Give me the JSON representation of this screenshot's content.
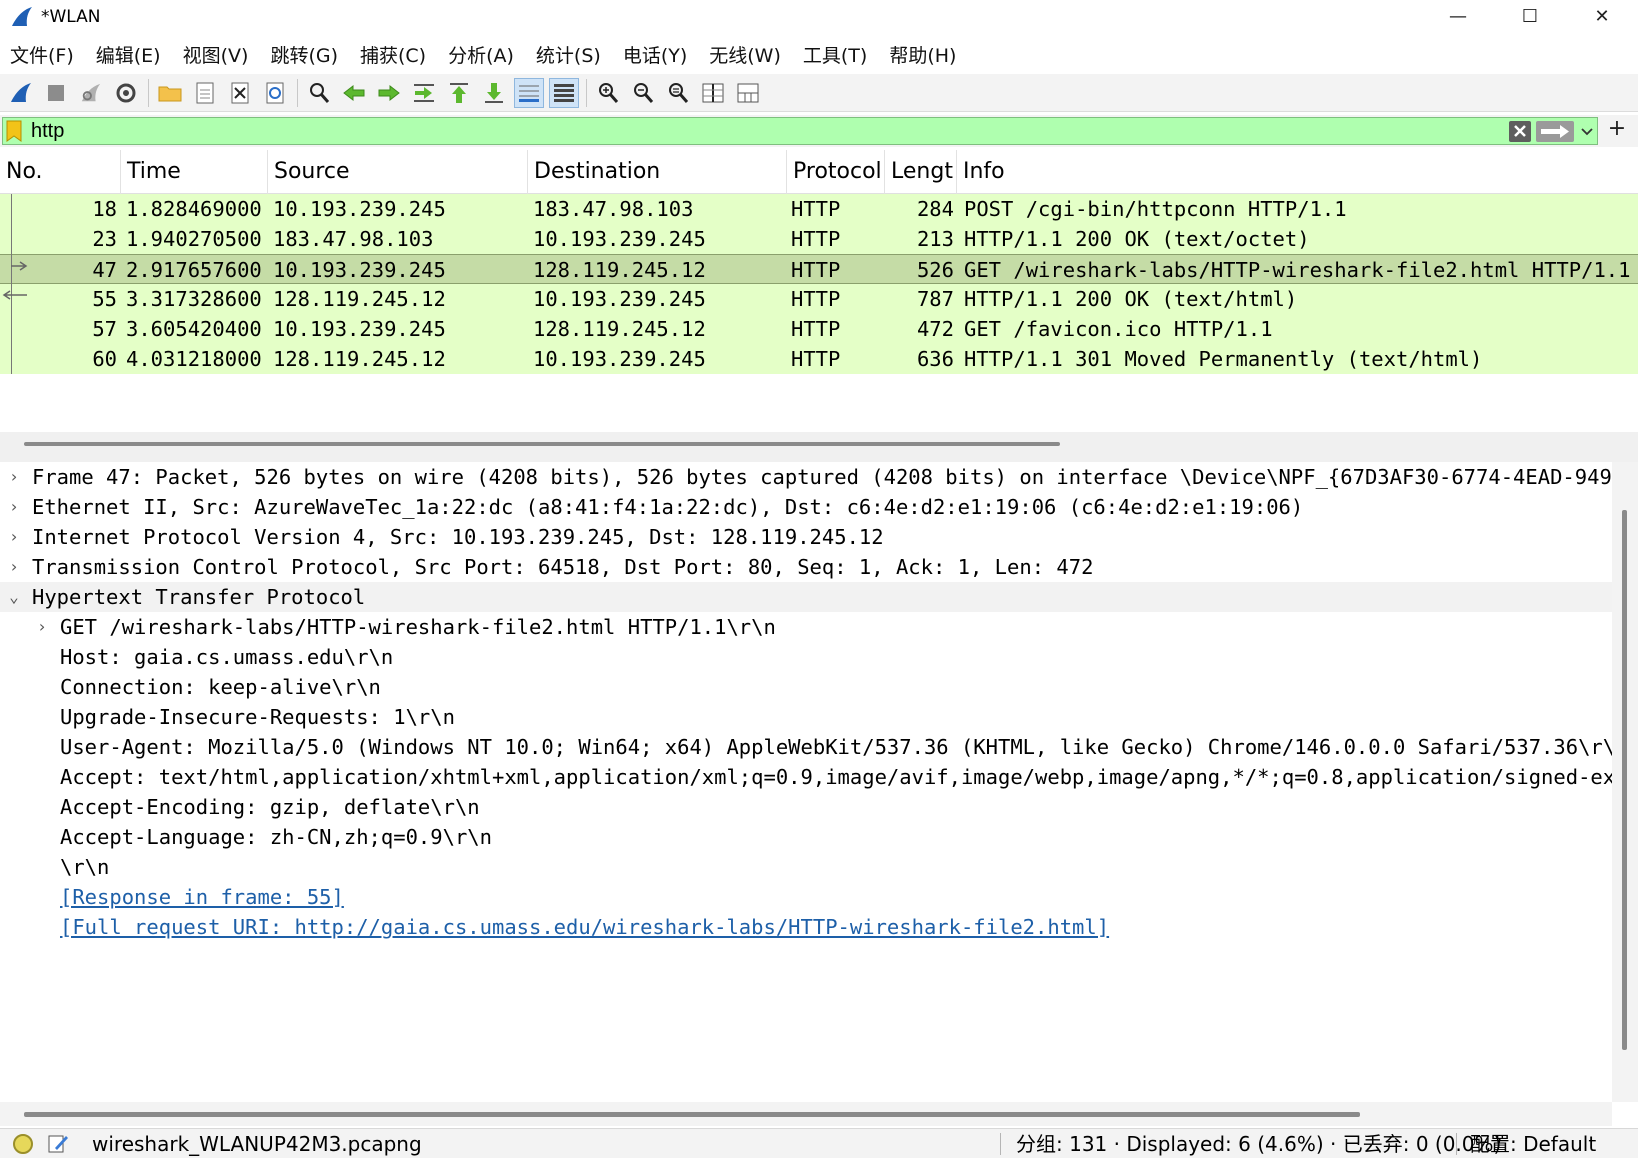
{
  "window": {
    "title": "*WLAN",
    "minimize": "—",
    "maximize": "☐",
    "close": "✕"
  },
  "menu": [
    "文件(F)",
    "编辑(E)",
    "视图(V)",
    "跳转(G)",
    "捕获(C)",
    "分析(A)",
    "统计(S)",
    "电话(Y)",
    "无线(W)",
    "工具(T)",
    "帮助(H)"
  ],
  "filter": {
    "value": "http",
    "add_label": "+"
  },
  "packet_list": {
    "columns": [
      "No.",
      "Time",
      "Source",
      "Destination",
      "Protocol",
      "Lengt",
      "Info"
    ],
    "rows": [
      {
        "no": "18",
        "time": "1.828469000",
        "src": "10.193.239.245",
        "dst": "183.47.98.103",
        "proto": "HTTP",
        "len": "284",
        "info": "POST /cgi-bin/httpconn HTTP/1.1"
      },
      {
        "no": "23",
        "time": "1.940270500",
        "src": "183.47.98.103",
        "dst": "10.193.239.245",
        "proto": "HTTP",
        "len": "213",
        "info": "HTTP/1.1 200 OK  (text/octet)"
      },
      {
        "no": "47",
        "time": "2.917657600",
        "src": "10.193.239.245",
        "dst": "128.119.245.12",
        "proto": "HTTP",
        "len": "526",
        "info": "GET /wireshark-labs/HTTP-wireshark-file2.html HTTP/1.1"
      },
      {
        "no": "55",
        "time": "3.317328600",
        "src": "128.119.245.12",
        "dst": "10.193.239.245",
        "proto": "HTTP",
        "len": "787",
        "info": "HTTP/1.1 200 OK  (text/html)"
      },
      {
        "no": "57",
        "time": "3.605420400",
        "src": "10.193.239.245",
        "dst": "128.119.245.12",
        "proto": "HTTP",
        "len": "472",
        "info": "GET /favicon.ico HTTP/1.1"
      },
      {
        "no": "60",
        "time": "4.031218000",
        "src": "128.119.245.12",
        "dst": "10.193.239.245",
        "proto": "HTTP",
        "len": "636",
        "info": "HTTP/1.1 301 Moved Permanently  (text/html)"
      }
    ],
    "selected_row": 2
  },
  "details": [
    {
      "level": 0,
      "arrow": "›",
      "text": "Frame 47: Packet, 526 bytes on wire (4208 bits), 526 bytes captured (4208 bits) on interface \\Device\\NPF_{67D3AF30-6774-4EAD-949"
    },
    {
      "level": 0,
      "arrow": "›",
      "text": "Ethernet II, Src: AzureWaveTec_1a:22:dc (a8:41:f4:1a:22:dc), Dst: c6:4e:d2:e1:19:06 (c6:4e:d2:e1:19:06)"
    },
    {
      "level": 0,
      "arrow": "›",
      "text": "Internet Protocol Version 4, Src: 10.193.239.245, Dst: 128.119.245.12"
    },
    {
      "level": 0,
      "arrow": "›",
      "text": "Transmission Control Protocol, Src Port: 64518, Dst Port: 80, Seq: 1, Ack: 1, Len: 472"
    },
    {
      "level": 0,
      "arrow": "⌄",
      "text": "Hypertext Transfer Protocol",
      "expanded": true
    },
    {
      "level": 1,
      "arrow": "›",
      "text": "GET /wireshark-labs/HTTP-wireshark-file2.html HTTP/1.1\\r\\n"
    },
    {
      "level": 1,
      "arrow": "",
      "text": "Host: gaia.cs.umass.edu\\r\\n"
    },
    {
      "level": 1,
      "arrow": "",
      "text": "Connection: keep-alive\\r\\n"
    },
    {
      "level": 1,
      "arrow": "",
      "text": "Upgrade-Insecure-Requests: 1\\r\\n"
    },
    {
      "level": 1,
      "arrow": "",
      "text": "User-Agent: Mozilla/5.0 (Windows NT 10.0; Win64; x64) AppleWebKit/537.36 (KHTML, like Gecko) Chrome/146.0.0.0 Safari/537.36\\r\\"
    },
    {
      "level": 1,
      "arrow": "",
      "text": "Accept: text/html,application/xhtml+xml,application/xml;q=0.9,image/avif,image/webp,image/apng,*/*;q=0.8,application/signed-ex"
    },
    {
      "level": 1,
      "arrow": "",
      "text": "Accept-Encoding: gzip, deflate\\r\\n"
    },
    {
      "level": 1,
      "arrow": "",
      "text": "Accept-Language: zh-CN,zh;q=0.9\\r\\n"
    },
    {
      "level": 1,
      "arrow": "",
      "text": "\\r\\n"
    },
    {
      "level": 1,
      "arrow": "",
      "text": "[Response in frame: 55]",
      "link": true
    },
    {
      "level": 1,
      "arrow": "",
      "text": "[Full request URI: http://gaia.cs.umass.edu/wireshark-labs/HTTP-wireshark-file2.html]",
      "link": true
    }
  ],
  "status": {
    "file": "wireshark_WLANUP42M3.pcapng",
    "stats": "分组: 131 · Displayed: 6 (4.6%) · 已丢弃: 0 (0.0%)",
    "profile": "配置: Default"
  },
  "colors": {
    "row_bg": "#e4ffc7",
    "row_selected": "#c5dca6",
    "filter_bg": "#afffaf",
    "link": "#1d5fa8"
  }
}
